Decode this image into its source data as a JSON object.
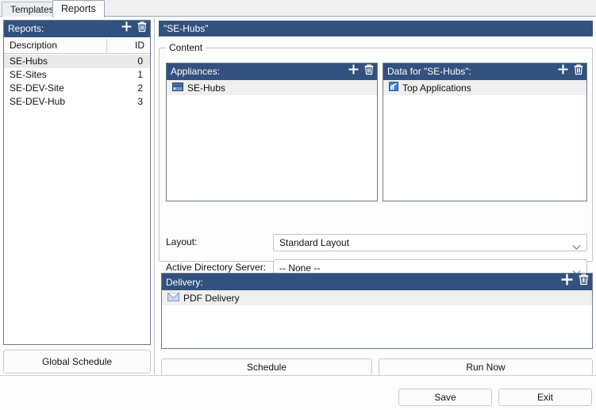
{
  "tabs": [
    {
      "label": "Templates",
      "active": false
    },
    {
      "label": "Reports",
      "active": true
    }
  ],
  "reports_panel": {
    "header": "Reports:",
    "add_icon": "plus-icon",
    "delete_icon": "trash-icon",
    "columns": [
      "Description",
      "ID"
    ],
    "rows": [
      {
        "description": "SE-Hubs",
        "id": "0",
        "selected": true
      },
      {
        "description": "SE-Sites",
        "id": "1",
        "selected": false
      },
      {
        "description": "SE-DEV-Site",
        "id": "2",
        "selected": false
      },
      {
        "description": "SE-DEV-Hub",
        "id": "3",
        "selected": false
      }
    ],
    "global_schedule_label": "Global Schedule"
  },
  "detail": {
    "title": "\"SE-Hubs\"",
    "content_legend": "Content",
    "appliances": {
      "header": "Appliances:",
      "items": [
        {
          "label": "SE-Hubs",
          "icon": "appliance-icon"
        }
      ]
    },
    "data": {
      "header": "Data for \"SE-Hubs\":",
      "items": [
        {
          "label": "Top Applications",
          "icon": "chart-icon"
        }
      ]
    },
    "layout": {
      "label": "Layout:",
      "value": "Standard Layout"
    },
    "active_directory": {
      "label": "Active Directory Server:",
      "value": "-- None --"
    },
    "delivery": {
      "header": "Delivery:",
      "items": [
        {
          "label": "PDF Delivery",
          "icon": "envelope-icon"
        }
      ]
    },
    "schedule_label": "Schedule",
    "run_now_label": "Run Now"
  },
  "footer": {
    "save_label": "Save",
    "exit_label": "Exit"
  },
  "colors": {
    "header_blue": "#33517e",
    "panel_border": "#6b7a90",
    "selection_grey": "#e9e9e9",
    "row_grey": "#efefef"
  }
}
